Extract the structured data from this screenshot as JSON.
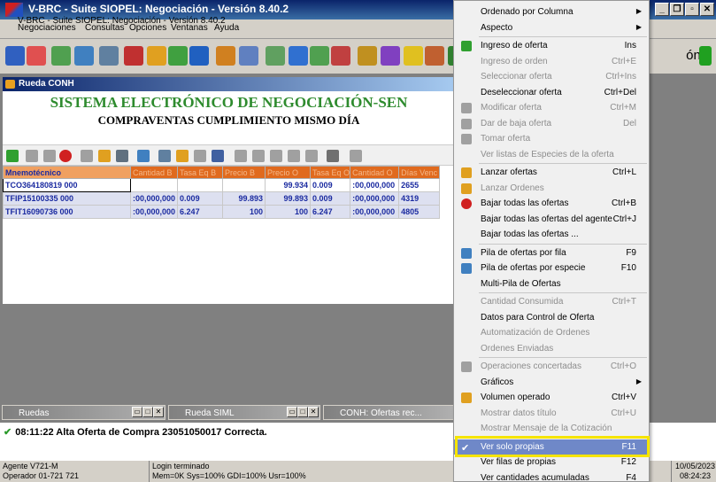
{
  "window": {
    "title": "V-BRC - Suite SIOPEL: Negociación - Versión 8.40.2",
    "ghost_title": "V-BRC - Suite SIOPEL: Negociación - Versión 8.40.2"
  },
  "menubar": [
    "Negociaciones",
    "Consultas",
    "Opciones",
    "Ventanas",
    "Ayuda"
  ],
  "toolbar": {
    "right_text": "ón -"
  },
  "child": {
    "title": "Rueda CONH",
    "heading": "SISTEMA ELECTRÓNICO DE NEGOCIACIÓN-SEN",
    "subheading": "COMPRAVENTAS CUMPLIMIENTO MISMO DÍA",
    "columns": [
      "Mnemotécnico",
      "Cantidad B",
      "Tasa Eq B",
      "Precio B",
      "Precio O",
      "Tasa Eq O",
      "Cantidad O",
      "Días Venc"
    ],
    "rows": [
      [
        "TCO364180819 000",
        "",
        "",
        "",
        "99.934",
        "0.009",
        ":00,000,000",
        "2655"
      ],
      [
        "TFIP15100335 000",
        ":00,000,000",
        "0.009",
        "99.893",
        "99.893",
        "0.009",
        ":00,000,000",
        "4319"
      ],
      [
        "TFIT16090736 000",
        ":00,000,000",
        "6.247",
        "100",
        "100",
        "6.247",
        ":00,000,000",
        "4805"
      ]
    ]
  },
  "minimized": [
    {
      "title": "Ruedas"
    },
    {
      "title": "Rueda SIML"
    },
    {
      "title": "CONH: Ofertas rec..."
    }
  ],
  "messages": {
    "line1": "08:11:22  Alta Oferta de Compra 23051050017 Correcta."
  },
  "status": {
    "agente": "Agente V721-M",
    "operador": "Operador 01-721 721",
    "login": "Login terminado",
    "mem": "Mem=0K Sys=100% GDI=100% Usr=100%",
    "date": "10/05/2023",
    "time": "08:24:23"
  },
  "context_menu": {
    "items": [
      {
        "label": "Ordenado por Columna",
        "shortcut": "",
        "submenu": true,
        "disabled": false,
        "icon": ""
      },
      {
        "label": "Aspecto",
        "shortcut": "",
        "submenu": true,
        "disabled": false,
        "icon": ""
      },
      {
        "label": "Ingreso de oferta",
        "shortcut": "Ins",
        "submenu": false,
        "disabled": false,
        "icon": "plus-icon"
      },
      {
        "label": "Ingreso de orden",
        "shortcut": "Ctrl+E",
        "submenu": false,
        "disabled": true,
        "icon": ""
      },
      {
        "label": "Seleccionar oferta",
        "shortcut": "Ctrl+Ins",
        "submenu": false,
        "disabled": true,
        "icon": ""
      },
      {
        "label": "Deseleccionar oferta",
        "shortcut": "Ctrl+Del",
        "submenu": false,
        "disabled": false,
        "icon": ""
      },
      {
        "label": "Modificar oferta",
        "shortcut": "Ctrl+M",
        "submenu": false,
        "disabled": true,
        "icon": "pencil-icon"
      },
      {
        "label": "Dar de baja oferta",
        "shortcut": "Del",
        "submenu": false,
        "disabled": true,
        "icon": "minus-icon"
      },
      {
        "label": "Tomar oferta",
        "shortcut": "",
        "submenu": false,
        "disabled": true,
        "icon": "hand-icon"
      },
      {
        "label": "Ver listas de Especies de la oferta",
        "shortcut": "",
        "submenu": false,
        "disabled": true,
        "icon": ""
      },
      {
        "label": "Lanzar ofertas",
        "shortcut": "Ctrl+L",
        "submenu": false,
        "disabled": false,
        "icon": "launch-icon"
      },
      {
        "label": "Lanzar Ordenes",
        "shortcut": "",
        "submenu": false,
        "disabled": true,
        "icon": "launch-icon"
      },
      {
        "label": "Bajar todas las ofertas",
        "shortcut": "Ctrl+B",
        "submenu": false,
        "disabled": false,
        "icon": "stop-icon"
      },
      {
        "label": "Bajar todas las ofertas del agente",
        "shortcut": "Ctrl+J",
        "submenu": false,
        "disabled": false,
        "icon": ""
      },
      {
        "label": "Bajar todas las ofertas ...",
        "shortcut": "",
        "submenu": false,
        "disabled": false,
        "icon": ""
      },
      {
        "label": "Pila de ofertas por fila",
        "shortcut": "F9",
        "submenu": false,
        "disabled": false,
        "icon": "stack-icon"
      },
      {
        "label": "Pila de ofertas por especie",
        "shortcut": "F10",
        "submenu": false,
        "disabled": false,
        "icon": "stack-icon"
      },
      {
        "label": "Multi-Pila de Ofertas",
        "shortcut": "",
        "submenu": false,
        "disabled": false,
        "icon": ""
      },
      {
        "label": "Cantidad Consumida",
        "shortcut": "Ctrl+T",
        "submenu": false,
        "disabled": true,
        "icon": ""
      },
      {
        "label": "Datos para Control de Oferta",
        "shortcut": "",
        "submenu": false,
        "disabled": false,
        "icon": ""
      },
      {
        "label": "Automatización de Ordenes",
        "shortcut": "",
        "submenu": false,
        "disabled": true,
        "icon": ""
      },
      {
        "label": "Ordenes Enviadas",
        "shortcut": "",
        "submenu": false,
        "disabled": true,
        "icon": ""
      },
      {
        "label": "Operaciones concertadas",
        "shortcut": "Ctrl+O",
        "submenu": false,
        "disabled": true,
        "icon": "grid-icon"
      },
      {
        "label": "Gráficos",
        "shortcut": "",
        "submenu": true,
        "disabled": false,
        "icon": ""
      },
      {
        "label": "Volumen operado",
        "shortcut": "Ctrl+V",
        "submenu": false,
        "disabled": false,
        "icon": "volume-icon"
      },
      {
        "label": "Mostrar datos título",
        "shortcut": "Ctrl+U",
        "submenu": false,
        "disabled": true,
        "icon": ""
      },
      {
        "label": "Mostrar Mensaje de la Cotización",
        "shortcut": "",
        "submenu": false,
        "disabled": true,
        "icon": ""
      },
      {
        "label": "Ver solo propias",
        "shortcut": "F11",
        "submenu": false,
        "disabled": false,
        "icon": "check-icon",
        "highlighted": true
      },
      {
        "label": "Ver filas de propias",
        "shortcut": "F12",
        "submenu": false,
        "disabled": false,
        "icon": ""
      },
      {
        "label": "Ver cantidades acumuladas",
        "shortcut": "F4",
        "submenu": false,
        "disabled": false,
        "icon": ""
      }
    ]
  }
}
